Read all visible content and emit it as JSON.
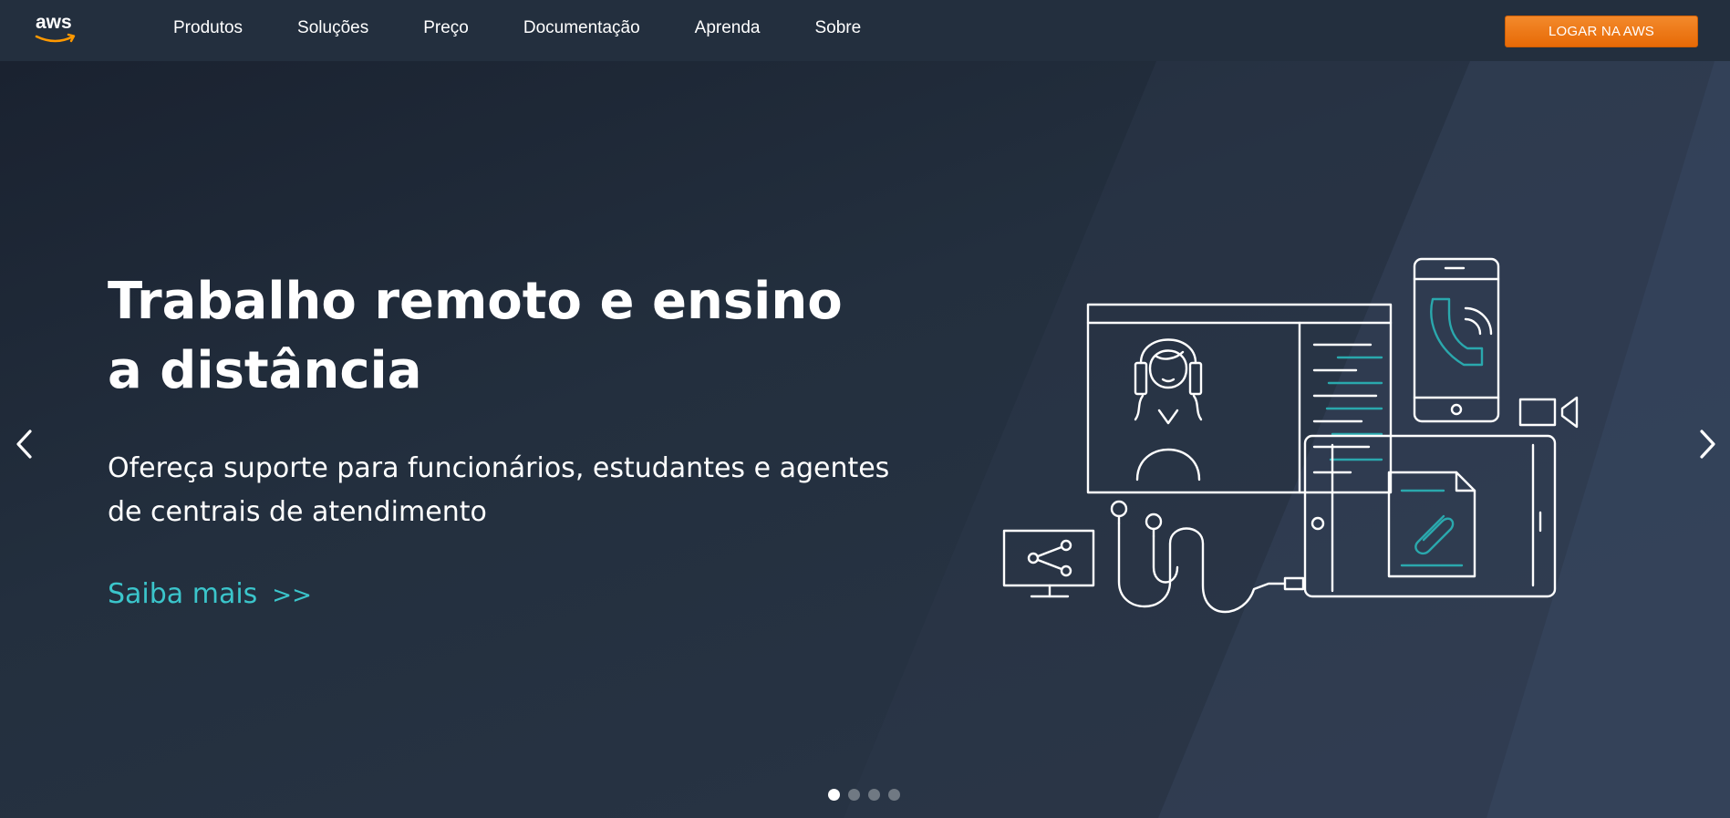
{
  "header": {
    "logo_text": "aws",
    "nav_items": [
      "Produtos",
      "Soluções",
      "Preço",
      "Documentação",
      "Aprenda",
      "Sobre"
    ],
    "login_label": "LOGAR NA AWS"
  },
  "hero": {
    "title_lines": [
      "Trabalho remoto e ensino",
      "a distância"
    ],
    "subtitle_lines": [
      "Ofereça suporte para funcionários, estudantes e agentes",
      "de centrais de atendimento"
    ],
    "cta_label": "Saiba mais",
    "cta_chevron": ">>",
    "prev_icon": "chevron-left-icon",
    "next_icon": "chevron-right-icon"
  },
  "carousel": {
    "slide_count": 4,
    "active_index": 0
  },
  "colors": {
    "background": "#232f3e",
    "accent_orange": "#ec7211",
    "accent_teal": "#3bc5cb",
    "text": "#ffffff"
  }
}
